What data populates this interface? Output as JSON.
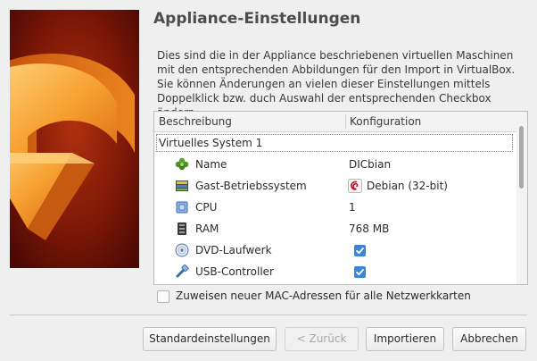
{
  "wizard": {
    "title": "Appliance-Einstellungen",
    "description": "Dies sind die in der Appliance beschriebenen virtuellen Maschinen mit den entsprechenden Abbildungen für den Import in VirtualBox. Sie können Änderungen an vielen dieser Einstellungen mittels Doppelklick bzw. duch Auswahl der entsprechenden Checkbox ändern."
  },
  "table": {
    "columns": [
      "Beschreibung",
      "Konfiguration"
    ],
    "group_label": "Virtuelles System 1",
    "rows": [
      {
        "icon": "name-icon",
        "label": "Name",
        "value": "DICbian"
      },
      {
        "icon": "guest-os-icon",
        "label": "Gast-Betriebssystem",
        "value": "Debian (32-bit)",
        "value_icon": "debian-icon"
      },
      {
        "icon": "cpu-icon",
        "label": "CPU",
        "value": "1"
      },
      {
        "icon": "ram-icon",
        "label": "RAM",
        "value": "768 MB"
      },
      {
        "icon": "dvd-icon",
        "label": "DVD-Laufwerk",
        "checked": true
      },
      {
        "icon": "usb-icon",
        "label": "USB-Controller",
        "checked": true
      }
    ]
  },
  "mac_option": {
    "label": "Zuweisen neuer MAC-Adressen für alle Netzwerkkarten",
    "checked": false
  },
  "buttons": {
    "defaults": "Standardeinstellungen",
    "back": "< Zurück",
    "import": "Importieren",
    "cancel": "Abbrechen"
  },
  "colors": {
    "accent": "#3c84d6",
    "banner_background": "#6e1206",
    "banner_arrow": "#f39a2a"
  }
}
